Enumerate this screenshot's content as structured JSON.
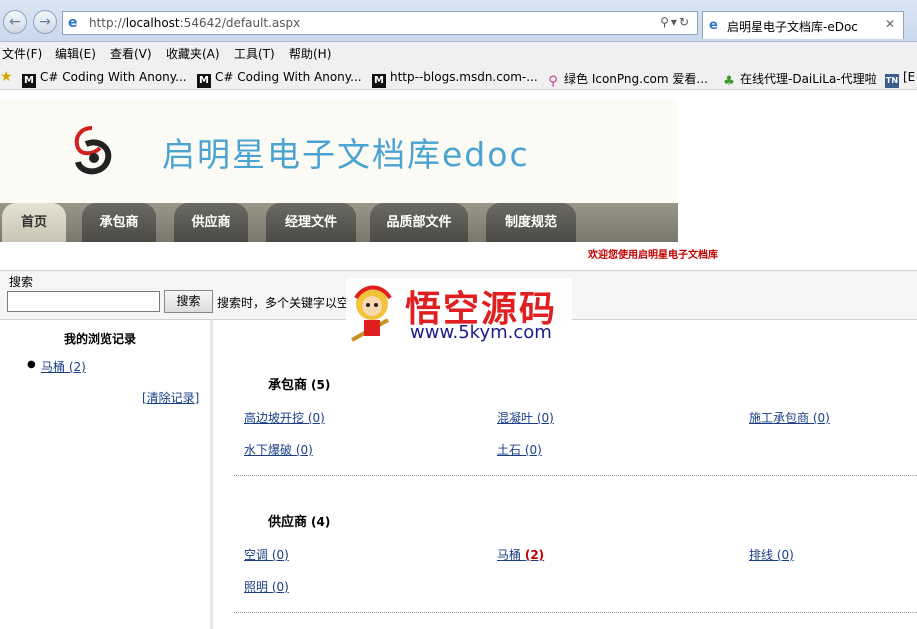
{
  "browser": {
    "url_prefix": "http://",
    "url_host": "localhost",
    "url_rest": ":54642/default.aspx",
    "tab_title": "启明星电子文档库-eDoc",
    "menu": [
      "文件(F)",
      "编辑(E)",
      "查看(V)",
      "收藏夹(A)",
      "工具(T)",
      "帮助(H)"
    ],
    "favorites": [
      {
        "icon": "M",
        "label": "C# Coding With Anony..."
      },
      {
        "icon": "M",
        "label": "C# Coding With Anony..."
      },
      {
        "icon": "M",
        "label": "http--blogs.msdn.com-..."
      },
      {
        "icon": "search",
        "label": "绿色 IconPng.com 爱看..."
      },
      {
        "icon": "tree",
        "label": "在线代理-DaiLiLa-代理啦"
      },
      {
        "icon": "TN",
        "label": "[E"
      }
    ]
  },
  "site": {
    "title": "启明星电子文档库edoc",
    "nav": [
      "首页",
      "承包商",
      "供应商",
      "经理文件",
      "品质部文件",
      "制度规范"
    ],
    "welcome": "欢迎您使用启明星电子文档库"
  },
  "search": {
    "label": "搜索",
    "button": "搜索",
    "hint": "搜索时，多个关键字以空",
    "value": ""
  },
  "watermark": {
    "text": "悟空源码",
    "url": "www.5kym.com"
  },
  "sidebar": {
    "title": "我的浏览记录",
    "items": [
      {
        "label": "马桶 (2)"
      }
    ],
    "clear": "[清除记录]"
  },
  "sections": [
    {
      "title": "承包商",
      "count": "(5)",
      "items": [
        "高边坡开挖 (0)",
        "混凝叶 (0)",
        "施工承包商 (0)",
        "水下爆破 (0)",
        "土石 (0)"
      ]
    },
    {
      "title": "供应商",
      "count": "(4)",
      "items": [
        "空调 (0)",
        "马桶 ",
        "排线 (0)",
        "照明 (0)"
      ],
      "highlight": {
        "index": 1,
        "text": "(2)"
      }
    }
  ],
  "colors": {
    "title_blue": "#4aa3d1",
    "welcome_red": "#c00000",
    "link_blue": "#1a3f86"
  }
}
